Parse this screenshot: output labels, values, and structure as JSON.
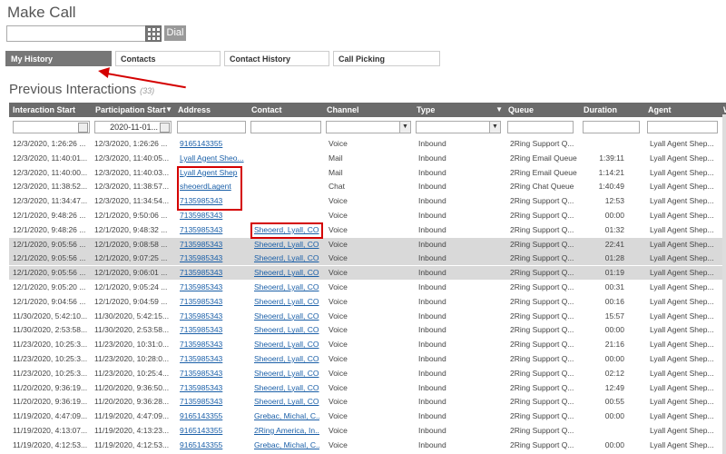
{
  "header": {
    "title": "Make Call",
    "dial_label": "Dial",
    "dial_placeholder": ""
  },
  "tabs": [
    {
      "label": "My History",
      "active": true
    },
    {
      "label": "Contacts",
      "active": false
    },
    {
      "label": "Contact History",
      "active": false
    },
    {
      "label": "Call Picking",
      "active": false
    }
  ],
  "section": {
    "title": "Previous Interactions",
    "count": "(33)"
  },
  "columns": [
    {
      "label": "Interaction Start"
    },
    {
      "label": "Participation Start"
    },
    {
      "label": "Address"
    },
    {
      "label": "Contact"
    },
    {
      "label": "Channel"
    },
    {
      "label": "Type"
    },
    {
      "label": "Queue"
    },
    {
      "label": "Duration"
    },
    {
      "label": "Agent"
    },
    {
      "label": "W"
    }
  ],
  "filters": {
    "participation_start": "2020-11-01..."
  },
  "rows": [
    {
      "interaction_start": "12/3/2020, 1:26:26 ...",
      "participation_start": "12/3/2020, 1:26:26 ...",
      "address": "9165143355",
      "contact": "",
      "channel": "Voice",
      "type": "Inbound",
      "queue": "2Ring Support Q...",
      "duration": "",
      "agent": "Lyall Agent Shep...",
      "highlight": false
    },
    {
      "interaction_start": "12/3/2020, 11:40:01...",
      "participation_start": "12/3/2020, 11:40:05...",
      "address": "Lyall Agent Sheo...",
      "contact": "",
      "channel": "Mail",
      "type": "Inbound",
      "queue": "2Ring Email Queue",
      "duration": "1:39:11",
      "agent": "Lyall Agent Shep...",
      "highlight": false
    },
    {
      "interaction_start": "12/3/2020, 11:40:00...",
      "participation_start": "12/3/2020, 11:40:03...",
      "address": "Lyall Agent Shep",
      "contact": "",
      "channel": "Mail",
      "type": "Inbound",
      "queue": "2Ring Email Queue",
      "duration": "1:14:21",
      "agent": "Lyall Agent Shep...",
      "highlight": false
    },
    {
      "interaction_start": "12/3/2020, 11:38:52...",
      "participation_start": "12/3/2020, 11:38:57...",
      "address": "sheoerdLagent",
      "contact": "",
      "channel": "Chat",
      "type": "Inbound",
      "queue": "2Ring Chat Queue",
      "duration": "1:40:49",
      "agent": "Lyall Agent Shep...",
      "highlight": false
    },
    {
      "interaction_start": "12/3/2020, 11:34:47...",
      "participation_start": "12/3/2020, 11:34:54...",
      "address": "7135985343",
      "contact": "",
      "channel": "Voice",
      "type": "Inbound",
      "queue": "2Ring Support Q...",
      "duration": "12:53",
      "agent": "Lyall Agent Shep...",
      "highlight": false
    },
    {
      "interaction_start": "12/1/2020, 9:48:26 ...",
      "participation_start": "12/1/2020, 9:50:06 ...",
      "address": "7135985343",
      "contact": "",
      "channel": "Voice",
      "type": "Inbound",
      "queue": "2Ring Support Q...",
      "duration": "00:00",
      "agent": "Lyall Agent Shep...",
      "highlight": false
    },
    {
      "interaction_start": "12/1/2020, 9:48:26 ...",
      "participation_start": "12/1/2020, 9:48:32 ...",
      "address": "7135985343",
      "contact": "Sheoerd, Lyall, CO",
      "channel": "Voice",
      "type": "Inbound",
      "queue": "2Ring Support Q...",
      "duration": "01:32",
      "agent": "Lyall Agent Shep...",
      "highlight": false
    },
    {
      "interaction_start": "12/1/2020, 9:05:56 ...",
      "participation_start": "12/1/2020, 9:08:58 ...",
      "address": "7135985343",
      "contact": "Sheoerd, Lyall, CO",
      "channel": "Voice",
      "type": "Inbound",
      "queue": "2Ring Support Q...",
      "duration": "22:41",
      "agent": "Lyall Agent Shep...",
      "highlight": true
    },
    {
      "interaction_start": "12/1/2020, 9:05:56 ...",
      "participation_start": "12/1/2020, 9:07:25 ...",
      "address": "7135985343",
      "contact": "Sheoerd, Lyall, CO",
      "channel": "Voice",
      "type": "Inbound",
      "queue": "2Ring Support Q...",
      "duration": "01:28",
      "agent": "Lyall Agent Shep...",
      "highlight": true
    },
    {
      "interaction_start": "12/1/2020, 9:05:56 ...",
      "participation_start": "12/1/2020, 9:06:01 ...",
      "address": "7135985343",
      "contact": "Sheoerd, Lyall, CO",
      "channel": "Voice",
      "type": "Inbound",
      "queue": "2Ring Support Q...",
      "duration": "01:19",
      "agent": "Lyall Agent Shep...",
      "highlight": true
    },
    {
      "interaction_start": "12/1/2020, 9:05:20 ...",
      "participation_start": "12/1/2020, 9:05:24 ...",
      "address": "7135985343",
      "contact": "Sheoerd, Lyall, CO",
      "channel": "Voice",
      "type": "Inbound",
      "queue": "2Ring Support Q...",
      "duration": "00:31",
      "agent": "Lyall Agent Shep...",
      "highlight": false
    },
    {
      "interaction_start": "12/1/2020, 9:04:56 ...",
      "participation_start": "12/1/2020, 9:04:59 ...",
      "address": "7135985343",
      "contact": "Sheoerd, Lyall, CO",
      "channel": "Voice",
      "type": "Inbound",
      "queue": "2Ring Support Q...",
      "duration": "00:16",
      "agent": "Lyall Agent Shep...",
      "highlight": false
    },
    {
      "interaction_start": "11/30/2020, 5:42:10...",
      "participation_start": "11/30/2020, 5:42:15...",
      "address": "7135985343",
      "contact": "Sheoerd, Lyall, CO",
      "channel": "Voice",
      "type": "Inbound",
      "queue": "2Ring Support Q...",
      "duration": "15:57",
      "agent": "Lyall Agent Shep...",
      "highlight": false
    },
    {
      "interaction_start": "11/30/2020, 2:53:58...",
      "participation_start": "11/30/2020, 2:53:58...",
      "address": "7135985343",
      "contact": "Sheoerd, Lyall, CO",
      "channel": "Voice",
      "type": "Inbound",
      "queue": "2Ring Support Q...",
      "duration": "00:00",
      "agent": "Lyall Agent Shep...",
      "highlight": false
    },
    {
      "interaction_start": "11/23/2020, 10:25:3...",
      "participation_start": "11/23/2020, 10:31:0...",
      "address": "7135985343",
      "contact": "Sheoerd, Lyall, CO",
      "channel": "Voice",
      "type": "Inbound",
      "queue": "2Ring Support Q...",
      "duration": "21:16",
      "agent": "Lyall Agent Shep...",
      "highlight": false
    },
    {
      "interaction_start": "11/23/2020, 10:25:3...",
      "participation_start": "11/23/2020, 10:28:0...",
      "address": "7135985343",
      "contact": "Sheoerd, Lyall, CO",
      "channel": "Voice",
      "type": "Inbound",
      "queue": "2Ring Support Q...",
      "duration": "00:00",
      "agent": "Lyall Agent Shep...",
      "highlight": false
    },
    {
      "interaction_start": "11/23/2020, 10:25:3...",
      "participation_start": "11/23/2020, 10:25:4...",
      "address": "7135985343",
      "contact": "Sheoerd, Lyall, CO",
      "channel": "Voice",
      "type": "Inbound",
      "queue": "2Ring Support Q...",
      "duration": "02:12",
      "agent": "Lyall Agent Shep...",
      "highlight": false
    },
    {
      "interaction_start": "11/20/2020, 9:36:19...",
      "participation_start": "11/20/2020, 9:36:50...",
      "address": "7135985343",
      "contact": "Sheoerd, Lyall, CO",
      "channel": "Voice",
      "type": "Inbound",
      "queue": "2Ring Support Q...",
      "duration": "12:49",
      "agent": "Lyall Agent Shep...",
      "highlight": false
    },
    {
      "interaction_start": "11/20/2020, 9:36:19...",
      "participation_start": "11/20/2020, 9:36:28...",
      "address": "7135985343",
      "contact": "Sheoerd, Lyall, CO",
      "channel": "Voice",
      "type": "Inbound",
      "queue": "2Ring Support Q...",
      "duration": "00:55",
      "agent": "Lyall Agent Shep...",
      "highlight": false
    },
    {
      "interaction_start": "11/19/2020, 4:47:09...",
      "participation_start": "11/19/2020, 4:47:09...",
      "address": "9165143355",
      "contact": "Grebac, Michal, C...",
      "channel": "Voice",
      "type": "Inbound",
      "queue": "2Ring Support Q...",
      "duration": "00:00",
      "agent": "Lyall Agent Shep...",
      "highlight": false
    },
    {
      "interaction_start": "11/19/2020, 4:13:07...",
      "participation_start": "11/19/2020, 4:13:23...",
      "address": "9165143355",
      "contact": "2Ring America, In...",
      "channel": "Voice",
      "type": "Inbound",
      "queue": "2Ring Support Q...",
      "duration": "",
      "agent": "Lyall Agent Shep...",
      "highlight": false
    },
    {
      "interaction_start": "11/19/2020, 4:12:53...",
      "participation_start": "11/19/2020, 4:12:53...",
      "address": "9165143355",
      "contact": "Grebac, Michal, C...",
      "channel": "Voice",
      "type": "Inbound",
      "queue": "2Ring Support Q...",
      "duration": "00:00",
      "agent": "Lyall Agent Shep...",
      "highlight": false
    }
  ],
  "colors": {
    "header_bg": "#6b6b6b",
    "active_tab": "#777777",
    "link": "#1a5fa8",
    "annotation": "#d40000",
    "row_highlight": "#d9d9d9"
  }
}
